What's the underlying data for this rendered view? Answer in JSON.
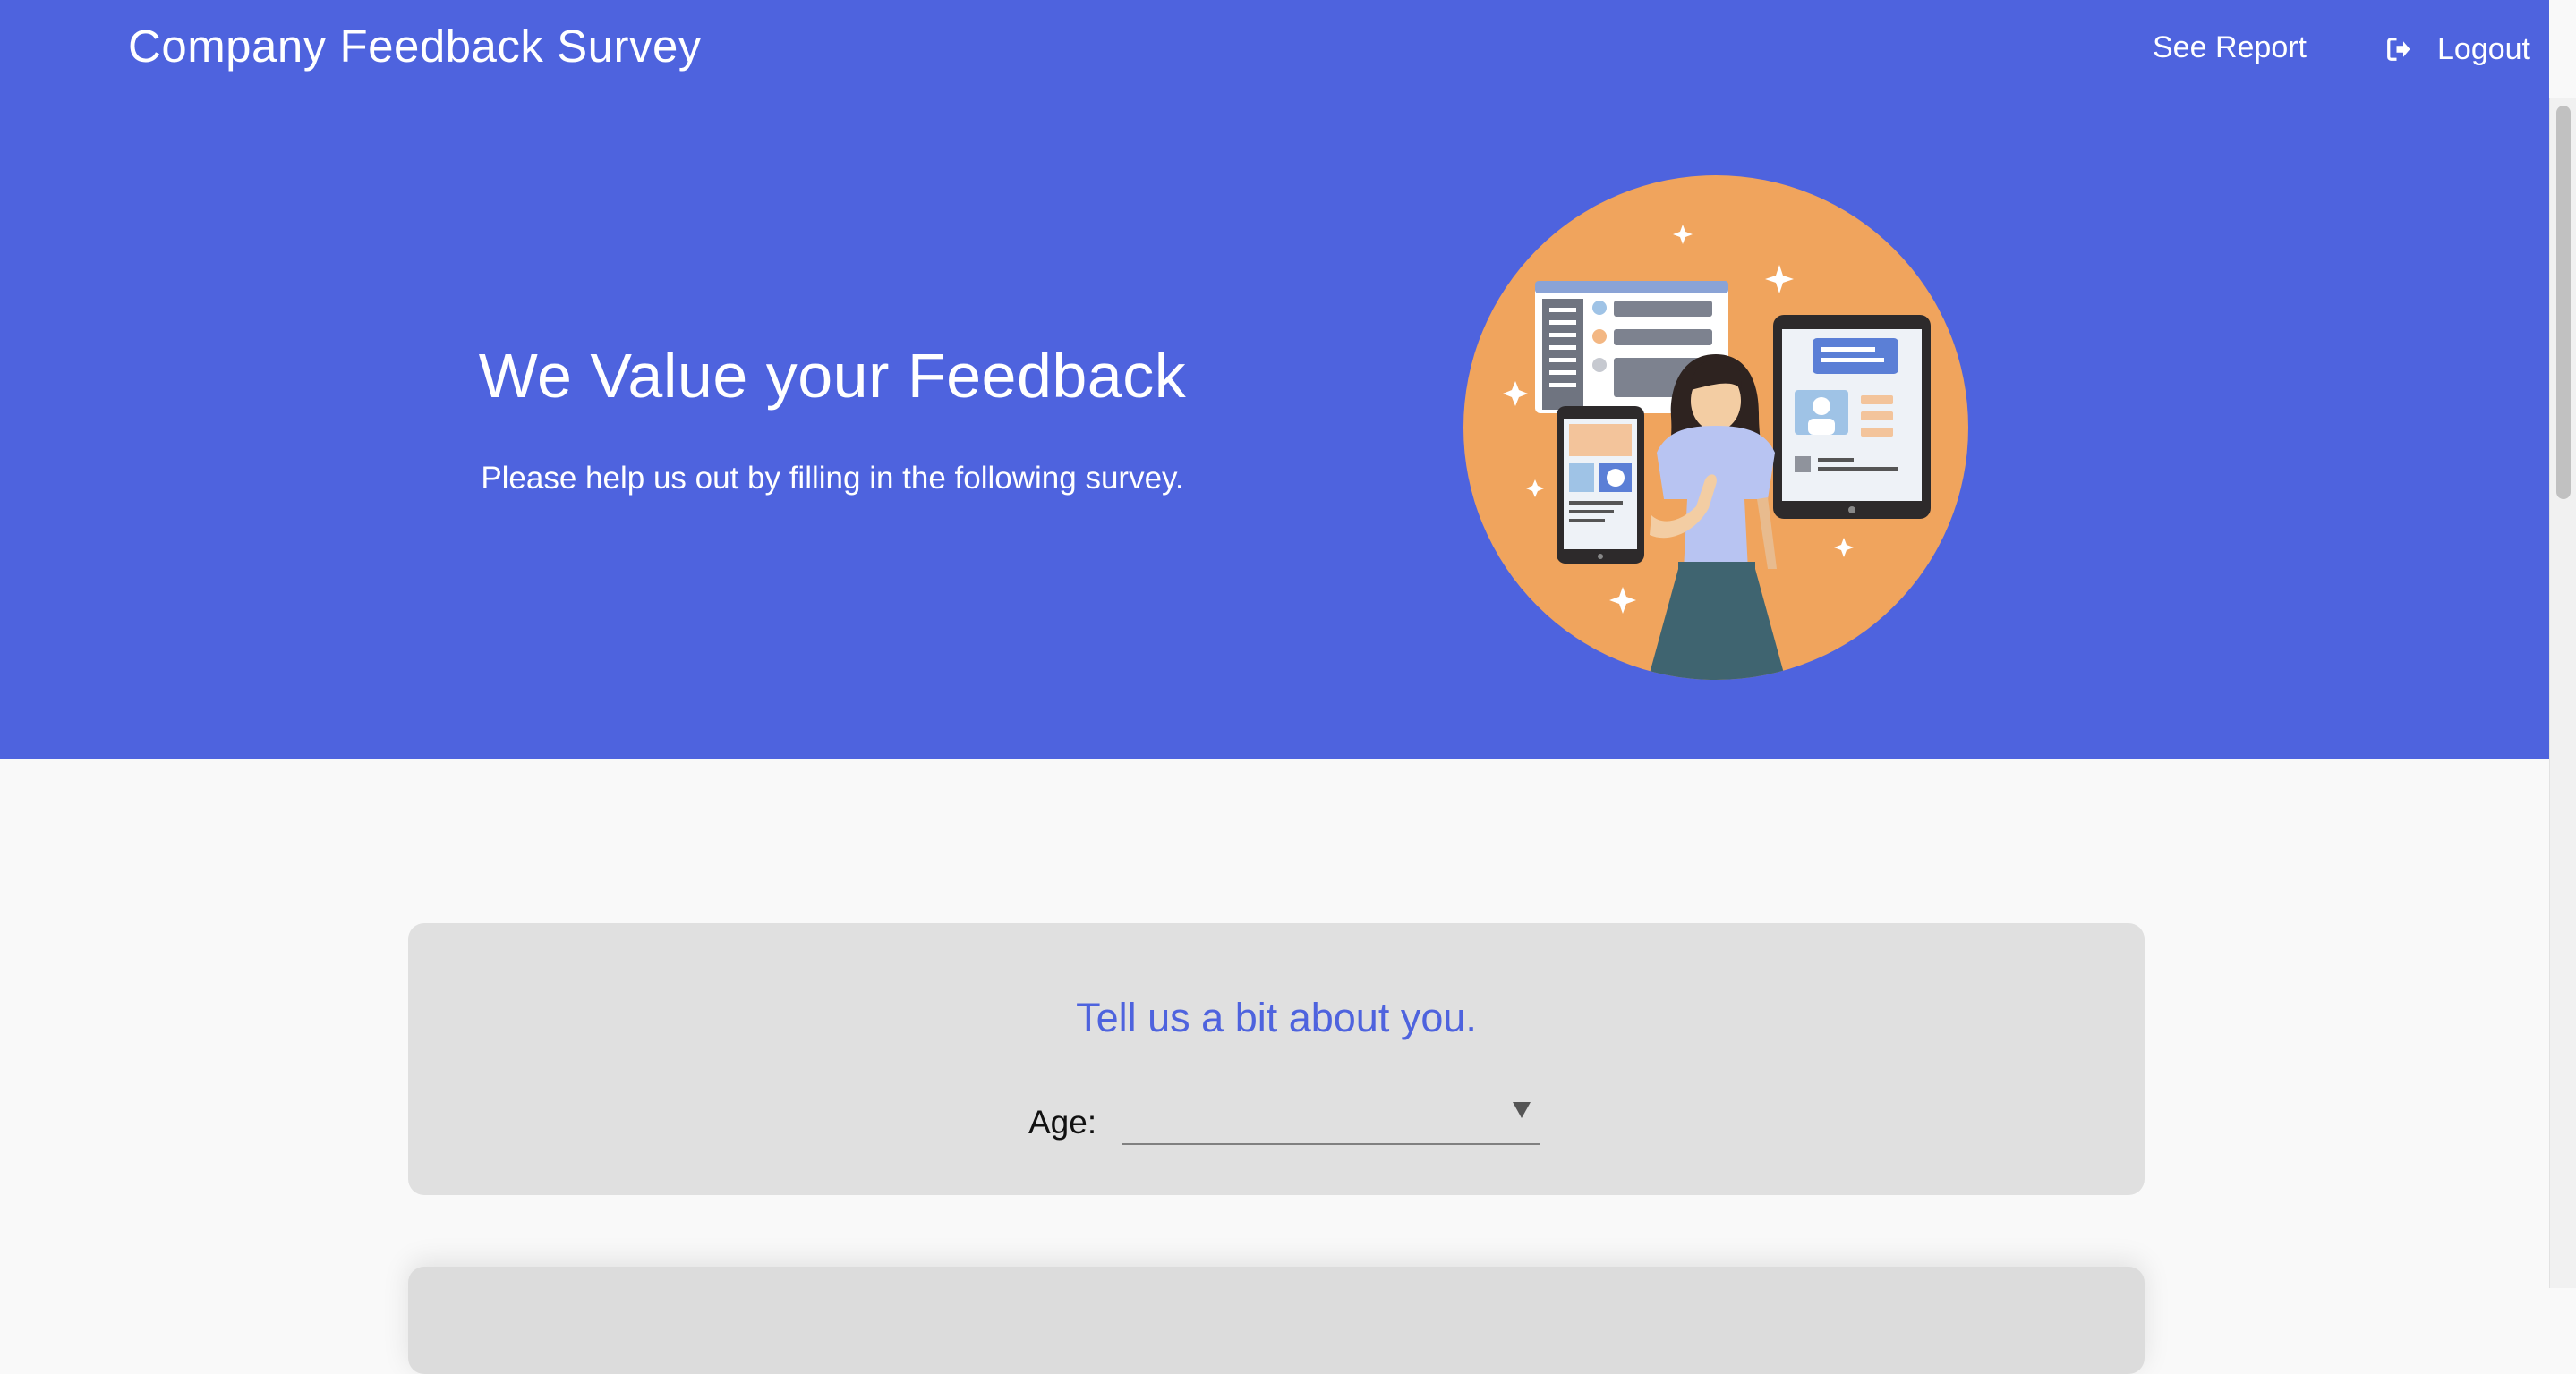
{
  "header": {
    "brand": "Company Feedback Survey",
    "nav": {
      "see_report": "See Report",
      "logout": "Logout",
      "logout_icon": "sign-out-icon"
    }
  },
  "hero": {
    "title": "We Value your Feedback",
    "subtitle": "Please help us out by filling in the following survey.",
    "illustration": "woman-with-devices-illustration"
  },
  "about_card": {
    "title": "Tell us a bit about you.",
    "age_label": "Age:",
    "age_value": "",
    "dropdown_icon": "caret-down-icon"
  },
  "colors": {
    "brand_blue": "#4e63de",
    "card_bg": "#e0e0e0",
    "page_bg": "#f9f9f9",
    "illustration_orange": "#f0a45d"
  }
}
